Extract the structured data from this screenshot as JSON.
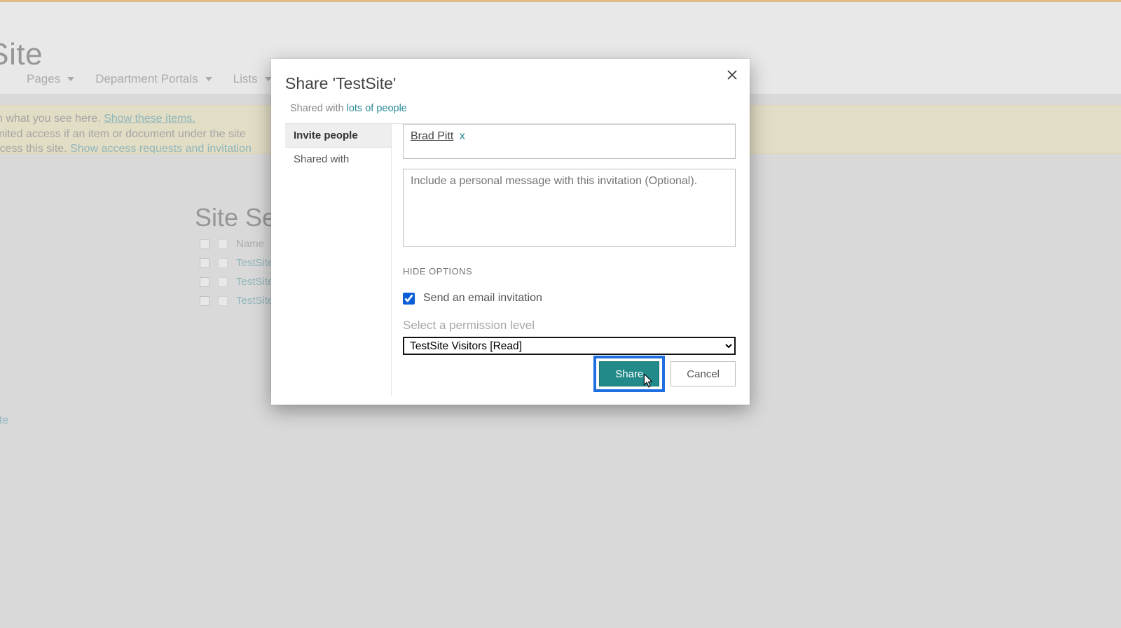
{
  "header": {
    "site_title": "stSite",
    "nav": {
      "pages": "Pages",
      "dept": "Department Portals",
      "lists": "Lists"
    }
  },
  "notice": {
    "line1_pre": "rmissions from what you see here.  ",
    "line1_link": "Show these items.",
    "line2_pre": "s may have limited access if an item or document under the site",
    "line3_pre": "at they can access this site. ",
    "line3_link": "Show access requests and invitation"
  },
  "page": {
    "heading": "Site Sett",
    "col_name": "Name",
    "rows": [
      "TestSite",
      "TestSite",
      "TestSite"
    ],
    "left_link": "ate"
  },
  "modal": {
    "title": "Share 'TestSite'",
    "shared_pre": "Shared with ",
    "shared_link": "lots of people",
    "tab_invite": "Invite people",
    "tab_shared": "Shared with",
    "person_name": "Brad Pitt",
    "person_remove": "x",
    "msg_placeholder": "Include a personal message with this invitation (Optional).",
    "hide_options": "HIDE OPTIONS",
    "send_email": "Send an email invitation",
    "perm_label": "Select a permission level",
    "perm_value": "TestSite Visitors [Read]",
    "share_btn": "Share",
    "cancel_btn": "Cancel"
  }
}
